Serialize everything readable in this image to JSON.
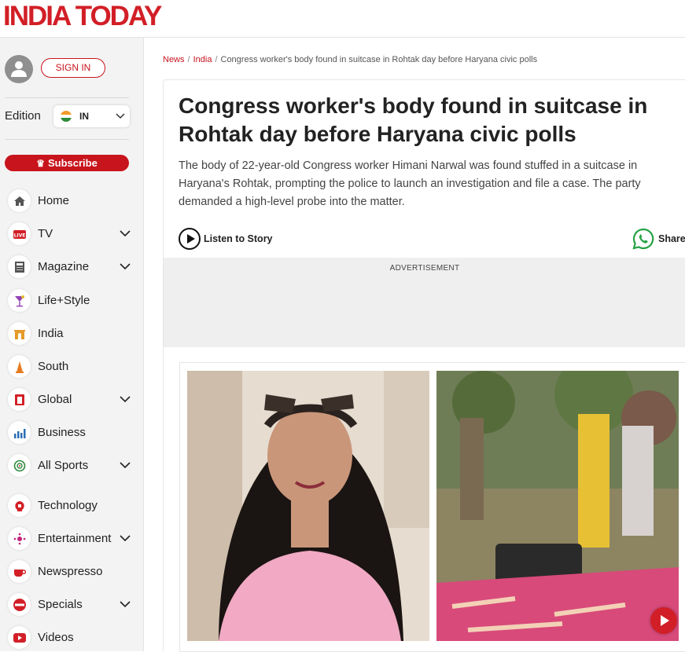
{
  "header": {
    "logo_text": "INDIA TODAY",
    "brand_color": "#d21f27"
  },
  "sidebar": {
    "sign_in_label": "SIGN IN",
    "edition_label": "Edition",
    "edition_value": "IN",
    "subscribe_label": "Subscribe",
    "items": [
      {
        "label": "Home",
        "icon": "home-icon",
        "has_submenu": false
      },
      {
        "label": "TV",
        "icon": "live-tv-icon",
        "has_submenu": true
      },
      {
        "label": "Magazine",
        "icon": "magazine-icon",
        "has_submenu": true
      },
      {
        "label": "Life+Style",
        "icon": "cocktail-icon",
        "has_submenu": false
      },
      {
        "label": "India",
        "icon": "india-gate-icon",
        "has_submenu": false
      },
      {
        "label": "South",
        "icon": "temple-icon",
        "has_submenu": false
      },
      {
        "label": "Global",
        "icon": "global-icon",
        "has_submenu": true
      },
      {
        "label": "Business",
        "icon": "business-chart-icon",
        "has_submenu": false
      },
      {
        "label": "All Sports",
        "icon": "sports-icon",
        "has_submenu": true
      },
      {
        "label": "Technology",
        "icon": "technology-icon",
        "has_submenu": false
      },
      {
        "label": "Entertainment",
        "icon": "entertainment-icon",
        "has_submenu": true
      },
      {
        "label": "Newspresso",
        "icon": "coffee-cup-icon",
        "has_submenu": false
      },
      {
        "label": "Specials",
        "icon": "specials-icon",
        "has_submenu": true
      },
      {
        "label": "Videos",
        "icon": "video-icon",
        "has_submenu": false
      }
    ]
  },
  "breadcrumb": {
    "items": [
      "News",
      "India"
    ],
    "current": "Congress worker's body found in suitcase in Rohtak day before Haryana civic polls"
  },
  "article": {
    "headline": "Congress worker's body found in suitcase in Rohtak day before Haryana civic polls",
    "summary": "The body of 22-year-old Congress worker Himani Narwal was found stuffed in a suitcase in Haryana's Rohtak, prompting the police to launch an investigation and file a case. The party demanded a high-level probe into the matter.",
    "listen_label": "Listen to Story",
    "share_label": "Share",
    "ad_label": "ADVERTISEMENT"
  }
}
